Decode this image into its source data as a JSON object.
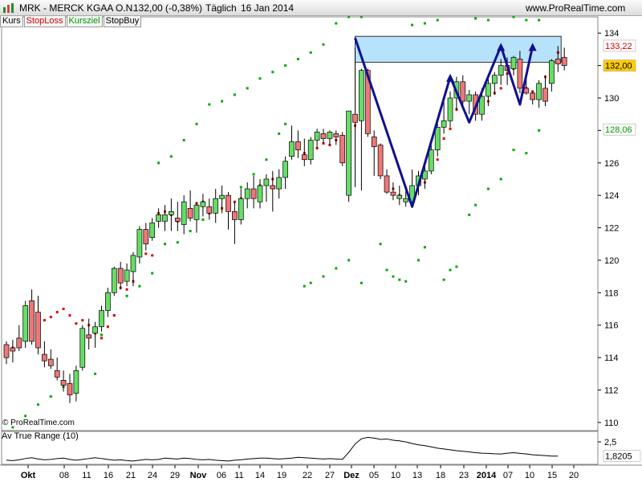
{
  "header": {
    "symbol": "MRK - MERCK KGAA O.N.",
    "quote": "132,00 (-0,38%)",
    "period": "Täglich",
    "date": "16 Jan 2014",
    "site": "www.ProRealTime.com"
  },
  "legend": {
    "kurs": "Kurs",
    "stoploss": "StopLoss",
    "kursziel": "Kursziel",
    "stopbuy": "StopBuy"
  },
  "copyright": "© ProRealTime.com",
  "atr_label": "Av True Range (10)",
  "colors": {
    "up": "#66dd66",
    "down": "#ee7777",
    "dot_green": "#00aa00",
    "dot_red": "#dd0000",
    "pattern": "#101090",
    "box_fill": "#b7e2fb",
    "price_badge": "#ffcc00"
  },
  "chart_data": {
    "type": "candlestick",
    "y_range": [
      109.5,
      135
    ],
    "y_ticks": [
      "110",
      "112",
      "114",
      "116",
      "118",
      "120",
      "122",
      "124",
      "126",
      "128",
      "130",
      "132",
      "134"
    ],
    "x_labels": [
      "Okt",
      "08",
      "11",
      "16",
      "21",
      "24",
      "29",
      "Nov",
      "06",
      "11",
      "14",
      "19",
      "22",
      "27",
      "Dez",
      "05",
      "10",
      "13",
      "18",
      "23",
      "2014",
      "07",
      "10",
      "15",
      "20"
    ],
    "price_labels": {
      "kursziel": "128,06",
      "stopbuy": "133,22",
      "last": "132,00"
    },
    "candles": [
      [
        114.8,
        115.0,
        113.6,
        114.0
      ],
      [
        114.6,
        115.1,
        113.7,
        114.4
      ],
      [
        115.2,
        116.0,
        114.4,
        114.6
      ],
      [
        115.0,
        117.5,
        114.6,
        117.2
      ],
      [
        117.5,
        118.2,
        114.8,
        115.0
      ],
      [
        116.8,
        117.8,
        114.2,
        114.6
      ],
      [
        114.2,
        115.0,
        113.4,
        113.8
      ],
      [
        113.9,
        114.5,
        113.3,
        113.5
      ],
      [
        113.2,
        114.0,
        112.6,
        112.8
      ],
      [
        112.6,
        113.2,
        111.9,
        112.3
      ],
      [
        112.4,
        113.0,
        111.2,
        111.7
      ],
      [
        111.8,
        113.5,
        111.3,
        113.2
      ],
      [
        113.4,
        116.0,
        113.2,
        115.8
      ],
      [
        115.4,
        116.4,
        114.5,
        115.2
      ],
      [
        115.5,
        116.2,
        114.6,
        115.9
      ],
      [
        115.9,
        117.2,
        115.6,
        116.9
      ],
      [
        116.9,
        118.3,
        116.5,
        118.0
      ],
      [
        118.0,
        119.6,
        117.8,
        119.5
      ],
      [
        119.5,
        119.9,
        118.2,
        118.6
      ],
      [
        118.7,
        119.8,
        118.4,
        119.4
      ],
      [
        119.3,
        120.5,
        118.4,
        120.3
      ],
      [
        120.2,
        122.1,
        119.8,
        121.9
      ],
      [
        121.9,
        122.3,
        120.6,
        121.0
      ],
      [
        121.4,
        122.6,
        121.2,
        122.3
      ],
      [
        122.4,
        123.2,
        122.0,
        122.8
      ],
      [
        122.4,
        123.4,
        121.8,
        122.8
      ],
      [
        122.8,
        123.8,
        121.8,
        123.0
      ],
      [
        122.6,
        123.6,
        121.8,
        122.4
      ],
      [
        122.2,
        124.0,
        121.6,
        123.6
      ],
      [
        123.2,
        124.3,
        122.4,
        122.6
      ],
      [
        122.5,
        123.6,
        121.7,
        123.4
      ],
      [
        123.3,
        124.1,
        122.7,
        123.6
      ],
      [
        123.3,
        123.8,
        122.5,
        122.9
      ],
      [
        122.9,
        124.4,
        122.3,
        123.8
      ],
      [
        123.8,
        124.6,
        122.9,
        124.0
      ],
      [
        124.0,
        124.2,
        121.9,
        123.0
      ],
      [
        123.0,
        123.6,
        121.0,
        122.5
      ],
      [
        122.5,
        124.4,
        122.2,
        123.8
      ],
      [
        123.8,
        124.8,
        123.2,
        124.4
      ],
      [
        124.4,
        125.2,
        123.2,
        123.8
      ],
      [
        123.6,
        125.0,
        123.2,
        124.6
      ],
      [
        124.6,
        125.3,
        123.6,
        125.0
      ],
      [
        124.6,
        125.5,
        123.0,
        124.4
      ],
      [
        124.4,
        125.6,
        123.8,
        125.1
      ],
      [
        125.1,
        126.4,
        124.4,
        126.1
      ],
      [
        126.4,
        128.3,
        126.2,
        127.3
      ],
      [
        127.3,
        128.0,
        126.3,
        126.8
      ],
      [
        126.5,
        127.5,
        125.8,
        126.2
      ],
      [
        126.2,
        127.6,
        125.9,
        127.4
      ],
      [
        127.4,
        128.1,
        126.9,
        127.9
      ],
      [
        127.8,
        128.1,
        127.2,
        127.5
      ],
      [
        127.5,
        128.0,
        127.1,
        127.9
      ],
      [
        127.8,
        128.0,
        127.1,
        127.6
      ],
      [
        127.7,
        127.9,
        125.8,
        126.0
      ],
      [
        124.0,
        129.2,
        123.6,
        129.2
      ],
      [
        129.0,
        133.1,
        124.5,
        128.5
      ],
      [
        128.6,
        131.8,
        124.3,
        131.7
      ],
      [
        131.7,
        131.8,
        127.6,
        127.8
      ],
      [
        127.6,
        128.0,
        125.2,
        127.0
      ],
      [
        127.1,
        127.2,
        125.0,
        125.2
      ],
      [
        125.2,
        125.6,
        124.1,
        124.2
      ],
      [
        124.2,
        124.8,
        123.7,
        124.0
      ],
      [
        123.8,
        124.6,
        123.4,
        124.0
      ],
      [
        123.6,
        124.4,
        123.3,
        123.8
      ],
      [
        123.6,
        125.6,
        123.4,
        124.6
      ],
      [
        124.6,
        125.5,
        124.0,
        125.2
      ],
      [
        125.0,
        126.0,
        124.4,
        125.5
      ],
      [
        125.5,
        127.2,
        125.3,
        126.8
      ],
      [
        126.8,
        128.5,
        126.4,
        128.2
      ],
      [
        128.2,
        129.8,
        127.8,
        128.6
      ],
      [
        128.6,
        130.4,
        128.2,
        130.0
      ],
      [
        130.0,
        131.3,
        129.2,
        131.0
      ],
      [
        131.0,
        131.4,
        129.5,
        129.8
      ],
      [
        129.8,
        130.5,
        129.0,
        130.2
      ],
      [
        130.2,
        130.4,
        128.6,
        129.0
      ],
      [
        129.0,
        130.6,
        128.6,
        130.1
      ],
      [
        130.1,
        131.4,
        129.5,
        130.9
      ],
      [
        130.9,
        131.6,
        130.2,
        131.4
      ],
      [
        131.4,
        132.4,
        130.8,
        132.0
      ],
      [
        132.0,
        132.5,
        130.8,
        131.7
      ],
      [
        131.8,
        132.6,
        131.4,
        132.5
      ],
      [
        132.4,
        132.9,
        130.3,
        130.6
      ],
      [
        130.6,
        131.2,
        130.2,
        130.3
      ],
      [
        130.3,
        130.4,
        129.6,
        129.9
      ],
      [
        129.9,
        131.1,
        129.4,
        130.9
      ],
      [
        130.6,
        131.4,
        129.5,
        129.8
      ],
      [
        130.9,
        132.4,
        130.4,
        132.3
      ],
      [
        132.4,
        133.2,
        131.6,
        132.1
      ],
      [
        132.5,
        133.1,
        131.7,
        132.0
      ]
    ],
    "kursziel_dots": [
      [
        1,
        109.7
      ],
      [
        3,
        110.4
      ],
      [
        5,
        111.1
      ],
      [
        7,
        111.6
      ],
      [
        9,
        112.2
      ],
      [
        11,
        112.3
      ],
      [
        14,
        113.0
      ],
      [
        15,
        115.4
      ],
      [
        17,
        116.6
      ],
      [
        19,
        117.8
      ],
      [
        21,
        118.4
      ],
      [
        23,
        119.2
      ],
      [
        25,
        121.0
      ],
      [
        27,
        121.1
      ],
      [
        29,
        121.8
      ],
      [
        31,
        122.5
      ],
      [
        33,
        123.0
      ],
      [
        35,
        123.6
      ],
      [
        37,
        124.5
      ],
      [
        39,
        125.3
      ],
      [
        41,
        126.2
      ],
      [
        43,
        127.8
      ],
      [
        44,
        128.4
      ],
      [
        47,
        118.4
      ],
      [
        48,
        118.6
      ],
      [
        50,
        119.0
      ],
      [
        52,
        119.5
      ],
      [
        54,
        120.0
      ],
      [
        56,
        118.6
      ],
      [
        59,
        121.0
      ],
      [
        60,
        119.4
      ],
      [
        61,
        119.0
      ],
      [
        62,
        118.8
      ],
      [
        63,
        118.7
      ],
      [
        65,
        120.0
      ],
      [
        66,
        120.8
      ],
      [
        69,
        118.8
      ],
      [
        70,
        119.4
      ],
      [
        71,
        119.6
      ],
      [
        73,
        122.8
      ],
      [
        74,
        123.4
      ],
      [
        76,
        124.4
      ],
      [
        78,
        125.0
      ],
      [
        80,
        126.8
      ],
      [
        82,
        126.6
      ],
      [
        84,
        128.0
      ]
    ],
    "stopbuy_dots": [
      [
        24,
        126.0
      ],
      [
        26,
        126.4
      ],
      [
        28,
        127.4
      ],
      [
        30,
        128.4
      ],
      [
        32,
        129.6
      ],
      [
        34,
        129.8
      ],
      [
        36,
        130.2
      ],
      [
        38,
        130.6
      ],
      [
        40,
        131.2
      ],
      [
        42,
        131.6
      ],
      [
        44,
        132.0
      ],
      [
        46,
        132.4
      ],
      [
        48,
        132.8
      ],
      [
        50,
        133.3
      ],
      [
        52,
        134.6
      ],
      [
        54,
        135.0
      ],
      [
        56,
        135.0
      ],
      [
        58,
        135.2
      ],
      [
        60,
        135.4
      ],
      [
        62,
        135.4
      ],
      [
        64,
        134.5
      ],
      [
        66,
        134.6
      ],
      [
        68,
        134.8
      ],
      [
        70,
        135.4
      ],
      [
        72,
        135.5
      ],
      [
        74,
        134.9
      ],
      [
        76,
        134.8
      ],
      [
        78,
        135.4
      ],
      [
        80,
        135.0
      ],
      [
        82,
        134.8
      ],
      [
        84,
        134.8
      ]
    ],
    "stoploss_dots": [
      [
        1,
        114.6
      ],
      [
        2,
        114.8
      ],
      [
        3,
        115.1
      ],
      [
        4,
        115.2
      ],
      [
        5,
        115.9
      ],
      [
        6,
        116.3
      ],
      [
        7,
        116.5
      ],
      [
        8,
        116.8
      ],
      [
        9,
        117.0
      ],
      [
        10,
        116.6
      ],
      [
        11,
        116.1
      ],
      [
        12,
        116.3
      ],
      [
        13,
        116.0
      ],
      [
        14,
        115.5
      ],
      [
        15,
        115.2
      ],
      [
        16,
        115.9
      ],
      [
        17,
        116.6
      ],
      [
        18,
        118.3
      ],
      [
        19,
        118.2
      ],
      [
        20,
        118.7
      ],
      [
        21,
        120.3
      ],
      [
        22,
        120.4
      ],
      [
        23,
        120.3
      ],
      [
        24,
        122.9
      ],
      [
        25,
        123.0
      ],
      [
        26,
        122.8
      ],
      [
        27,
        122.4
      ],
      [
        28,
        123.4
      ],
      [
        29,
        122.8
      ],
      [
        30,
        123.5
      ],
      [
        31,
        123.6
      ],
      [
        32,
        122.9
      ],
      [
        33,
        123.2
      ],
      [
        34,
        123.2
      ],
      [
        35,
        123.4
      ],
      [
        36,
        123.6
      ],
      [
        37,
        123.8
      ],
      [
        38,
        124.3
      ],
      [
        39,
        124.1
      ],
      [
        40,
        124.6
      ],
      [
        41,
        124.9
      ],
      [
        42,
        125.0
      ],
      [
        43,
        124.9
      ],
      [
        44,
        125.5
      ],
      [
        45,
        126.6
      ],
      [
        46,
        127.0
      ],
      [
        47,
        126.6
      ],
      [
        48,
        126.6
      ],
      [
        49,
        126.9
      ],
      [
        50,
        127.2
      ],
      [
        51,
        127.1
      ],
      [
        52,
        127.4
      ],
      [
        53,
        127.0
      ],
      [
        54,
        126.8
      ],
      [
        55,
        128.3
      ],
      [
        56,
        128.7
      ],
      [
        57,
        128.0
      ],
      [
        58,
        127.5
      ],
      [
        59,
        126.9
      ],
      [
        60,
        124.6
      ],
      [
        61,
        124.4
      ],
      [
        62,
        124.0
      ],
      [
        63,
        123.7
      ],
      [
        64,
        124.5
      ],
      [
        65,
        124.8
      ],
      [
        66,
        124.8
      ],
      [
        67,
        125.8
      ],
      [
        68,
        126.2
      ],
      [
        69,
        127.5
      ],
      [
        70,
        128.1
      ],
      [
        71,
        129.3
      ],
      [
        72,
        129.9
      ],
      [
        73,
        130.1
      ],
      [
        74,
        129.3
      ],
      [
        75,
        129.6
      ],
      [
        76,
        129.8
      ],
      [
        77,
        130.3
      ],
      [
        78,
        130.6
      ],
      [
        79,
        131.5
      ],
      [
        80,
        131.8
      ],
      [
        81,
        130.8
      ],
      [
        82,
        130.6
      ],
      [
        83,
        130.4
      ],
      [
        84,
        130.8
      ],
      [
        85,
        131.3
      ],
      [
        86,
        131.3
      ],
      [
        87,
        132.8
      ]
    ],
    "pattern": [
      [
        55,
        133.7
      ],
      [
        64,
        123.3
      ],
      [
        70,
        131.3
      ],
      [
        73,
        128.5
      ],
      [
        78,
        133.2
      ],
      [
        81,
        129.6
      ],
      [
        83,
        133.2
      ]
    ],
    "target_box": {
      "x_start": 55,
      "x_end": 87.5,
      "y_low": 132.2,
      "y_high": 133.8
    },
    "atr": {
      "ticks": [
        "2,5"
      ],
      "last_label": "1,8205",
      "values": [
        1.62,
        1.6,
        1.64,
        1.7,
        1.74,
        1.68,
        1.64,
        1.66,
        1.7,
        1.72,
        1.66,
        1.62,
        1.66,
        1.7,
        1.74,
        1.7,
        1.66,
        1.62,
        1.64,
        1.6,
        1.58,
        1.62,
        1.66,
        1.64,
        1.66,
        1.72,
        1.7,
        1.68,
        1.72,
        1.7,
        1.66,
        1.64,
        1.66,
        1.62,
        1.6,
        1.58,
        1.62,
        1.64,
        1.68,
        1.7,
        1.72,
        1.72,
        1.7,
        1.68,
        1.7,
        1.72,
        1.76,
        1.74,
        1.72,
        1.7,
        1.68,
        1.7,
        1.68,
        1.66,
        2.0,
        2.4,
        2.65,
        2.72,
        2.68,
        2.62,
        2.64,
        2.58,
        2.55,
        2.5,
        2.42,
        2.36,
        2.32,
        2.26,
        2.2,
        2.16,
        2.12,
        2.08,
        2.05,
        2.02,
        1.98,
        1.96,
        1.95,
        1.93,
        1.92,
        1.96,
        1.98,
        1.95,
        1.92,
        1.88,
        1.86,
        1.84,
        1.82,
        1.82
      ],
      "y_range": [
        1.5,
        2.85
      ]
    }
  }
}
